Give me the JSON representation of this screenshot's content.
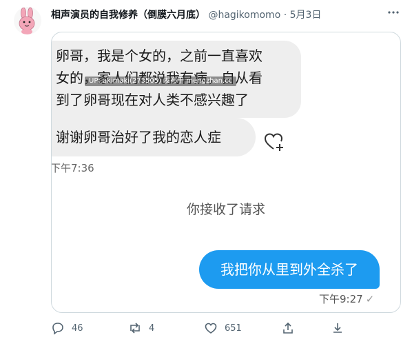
{
  "tweet": {
    "author_name": "相声演员的自我修养（倒膜六月底）",
    "handle": "@hagikomomo",
    "separator": "·",
    "date": "5月3日"
  },
  "screenshot": {
    "message_1": [
      "卵哥，我是个女的，之前一直喜欢",
      "女的，家人们都说我有病，自从看",
      "到了卵哥现在对人类不感兴趣了"
    ],
    "watermark": "UP: akimaki(273505) 发布于 mengzhan.cc",
    "message_2": "谢谢卵哥治好了我的恋人症",
    "time_1": "下午7:36",
    "notice": "你接收了请求",
    "reply": "我把你从里到外全杀了",
    "time_2": "下午9:27",
    "read_mark": "✓"
  },
  "actions": {
    "reply_count": "46",
    "retweet_count": "4",
    "like_count": "651"
  },
  "colors": {
    "accent": "#1d9bf0",
    "bubble_gray": "#eeeeee",
    "muted": "#536471",
    "avatar_pink": "#f3a6b8"
  },
  "icons": [
    "rabbit-avatar",
    "more-icon",
    "heart-plus-icon",
    "reply-icon",
    "retweet-icon",
    "like-icon",
    "share-icon",
    "upload-icon"
  ]
}
